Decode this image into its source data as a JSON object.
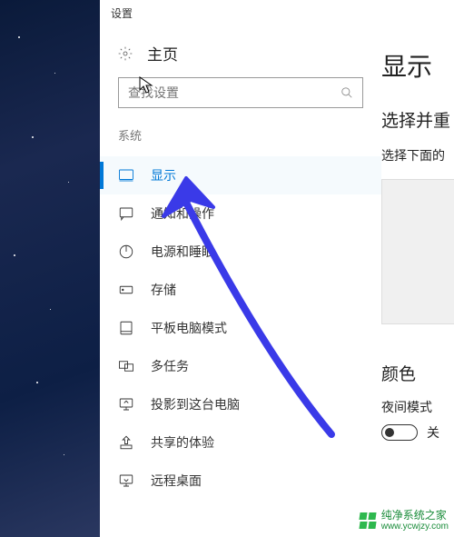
{
  "window": {
    "title": "设置"
  },
  "home": {
    "label": "主页"
  },
  "search": {
    "placeholder": "查找设置"
  },
  "category": {
    "label": "系统"
  },
  "nav": {
    "items": [
      {
        "id": "display",
        "label": "显示",
        "active": true
      },
      {
        "id": "notifications",
        "label": "通知和操作"
      },
      {
        "id": "power",
        "label": "电源和睡眠"
      },
      {
        "id": "storage",
        "label": "存储"
      },
      {
        "id": "tablet",
        "label": "平板电脑模式"
      },
      {
        "id": "multitask",
        "label": "多任务"
      },
      {
        "id": "projecting",
        "label": "投影到这台电脑"
      },
      {
        "id": "shared",
        "label": "共享的体验"
      },
      {
        "id": "remote",
        "label": "远程桌面"
      }
    ]
  },
  "page": {
    "title": "显示",
    "subheading": "选择并重",
    "description": "选择下面的",
    "color_heading": "颜色",
    "night_mode_label": "夜间模式",
    "night_mode_state": "关"
  },
  "watermark": {
    "name": "纯净系统之家",
    "url": "www.ycwjzy.com"
  }
}
